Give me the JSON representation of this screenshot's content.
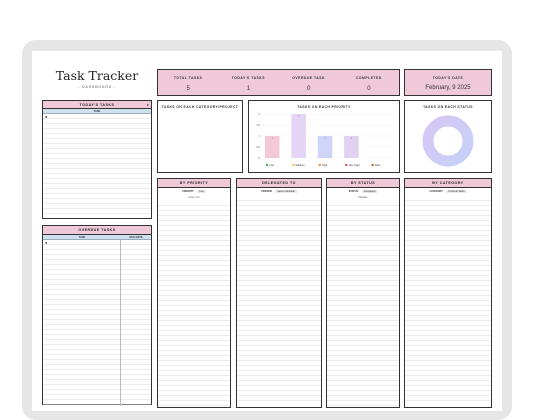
{
  "header": {
    "title": "Task Tracker",
    "subtitle": "- DASHBOARD -"
  },
  "stats": [
    {
      "label": "TOTAL TASKS",
      "value": "5"
    },
    {
      "label": "TODAY'S TASKS",
      "value": "1"
    },
    {
      "label": "OVERDUE TASK",
      "value": "0"
    },
    {
      "label": "COMPLETED",
      "value": "0"
    }
  ],
  "date": {
    "label": "TODAY'S DATE",
    "value": "February, 9 2025"
  },
  "todays_tasks": {
    "title": "TODAY'S TASKS",
    "column": "TASK",
    "bullet": "●"
  },
  "overdue_tasks": {
    "title": "OVERDUE TASKS",
    "col1": "TASK",
    "col2": "DUE DATE",
    "bullet": "●"
  },
  "category_panel": {
    "title": "TASKS ON EACH CATEGORY/PROJECT"
  },
  "priority_panel": {
    "title": "TASKS ON EACH PRIORITY"
  },
  "status_panel": {
    "title": "TASKS ON EACH STATUS"
  },
  "chart_data": {
    "type": "bar",
    "title": "TASKS ON EACH PRIORITY",
    "categories": [
      "Low",
      "Medium",
      "High",
      "Very High",
      "Date"
    ],
    "values": [
      1,
      2,
      1,
      1,
      0
    ],
    "ylim": [
      0,
      2
    ],
    "yticks": [
      "0",
      "0.5",
      "1",
      "1.5",
      "2"
    ],
    "colors": [
      "#f3c9d6",
      "#e5d4f5",
      "#cfd5f7",
      "#e2d0f3",
      "#f0e4b3"
    ],
    "legend_colors": [
      "#4caf50",
      "#f4c542",
      "#f08c2a",
      "#d9534f",
      "#b07a3a"
    ]
  },
  "donut": {
    "colors": [
      "#d6c6f5",
      "#c6d2f7"
    ]
  },
  "columns": [
    {
      "title": "BY PRIORITY",
      "filter_key": "PRIORITY:",
      "filter_value": "Low",
      "result": "Study, test"
    },
    {
      "title": "DELEGATED TO",
      "filter_key": "PERSON:",
      "filter_value": "Select individual",
      "result": ""
    },
    {
      "title": "BY STATUS",
      "filter_key": "STATUS:",
      "filter_value": "Completed",
      "result": "Meditate"
    },
    {
      "title": "BY CATEGORY",
      "filter_key": "CATEGORY:",
      "filter_value": "Personal Tasks",
      "result": ""
    }
  ]
}
